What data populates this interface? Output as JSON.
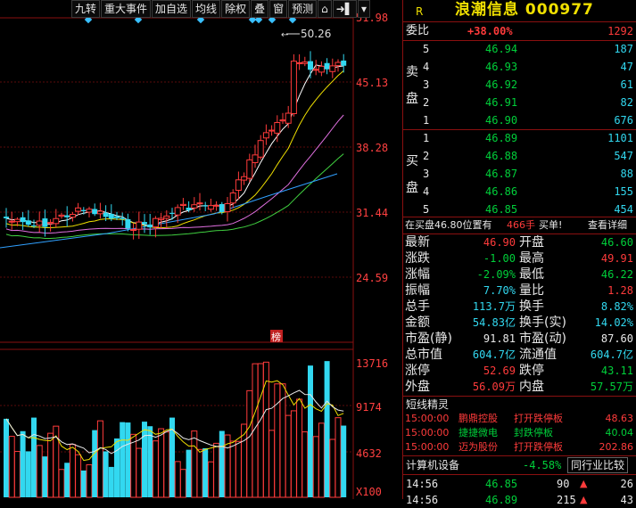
{
  "toolbar": {
    "items": [
      "九转",
      "重大事件",
      "加自选",
      "均线",
      "除权",
      "叠",
      "窗",
      "预测"
    ],
    "lock": "⌂",
    "arrow": "➜▌",
    "dropdown": "▾"
  },
  "chart": {
    "price_labels": [
      "51.98",
      "45.13",
      "38.28",
      "31.44",
      "24.59"
    ],
    "volume_labels": [
      "13716",
      "9174",
      "4632",
      "X100"
    ],
    "peak_label": "50.26",
    "badge": "榜"
  },
  "header": {
    "tag": "R",
    "title": "浪潮信息 000977"
  },
  "order": {
    "wb_label": "委比",
    "wb_pct": "+38.00%",
    "wb_diff": "1292",
    "sell_label": [
      "卖",
      "盘"
    ],
    "buy_label": [
      "买",
      "盘"
    ],
    "sell": [
      {
        "lvl": "5",
        "price": "46.94",
        "vol": "187"
      },
      {
        "lvl": "4",
        "price": "46.93",
        "vol": "47"
      },
      {
        "lvl": "3",
        "price": "46.92",
        "vol": "61"
      },
      {
        "lvl": "2",
        "price": "46.91",
        "vol": "82"
      },
      {
        "lvl": "1",
        "price": "46.90",
        "vol": "676"
      }
    ],
    "buy": [
      {
        "lvl": "1",
        "price": "46.89",
        "vol": "1101"
      },
      {
        "lvl": "2",
        "price": "46.88",
        "vol": "547"
      },
      {
        "lvl": "3",
        "price": "46.87",
        "vol": "88"
      },
      {
        "lvl": "4",
        "price": "46.86",
        "vol": "155"
      },
      {
        "lvl": "5",
        "price": "46.85",
        "vol": "454"
      }
    ]
  },
  "alert": {
    "text1": "在买盘46.80位置有",
    "text2": "466手",
    "text3": "买单!",
    "link": "查看详细"
  },
  "quote": [
    {
      "l1": "最新",
      "v1": "46.90",
      "c1": "red",
      "l2": "开盘",
      "v2": "46.60",
      "c2": "green"
    },
    {
      "l1": "涨跌",
      "v1": "-1.00",
      "c1": "green",
      "l2": "最高",
      "v2": "49.91",
      "c2": "red"
    },
    {
      "l1": "涨幅",
      "v1": "-2.09%",
      "c1": "green",
      "l2": "最低",
      "v2": "46.22",
      "c2": "green"
    },
    {
      "l1": "振幅",
      "v1": "7.70%",
      "c1": "cyan",
      "l2": "量比",
      "v2": "1.28",
      "c2": "red"
    },
    {
      "l1": "总手",
      "v1": "113.7万",
      "c1": "cyan",
      "l2": "换手",
      "v2": "8.82%",
      "c2": "cyan"
    },
    {
      "l1": "金额",
      "v1": "54.83亿",
      "c1": "cyan",
      "l2": "换手(实)",
      "v2": "14.02%",
      "c2": "cyan"
    },
    {
      "l1": "市盈(静)",
      "v1": "91.81",
      "c1": "white",
      "l2": "市盈(动)",
      "v2": "87.60",
      "c2": "white"
    },
    {
      "l1": "总市值",
      "v1": "604.7亿",
      "c1": "cyan",
      "l2": "流通值",
      "v2": "604.7亿",
      "c2": "cyan"
    },
    {
      "l1": "涨停",
      "v1": "52.69",
      "c1": "red",
      "l2": "跌停",
      "v2": "43.11",
      "c2": "green"
    },
    {
      "l1": "外盘",
      "v1": "56.09万",
      "c1": "red",
      "l2": "内盘",
      "v2": "57.57万",
      "c2": "green"
    }
  ],
  "sprite": {
    "title": "短线精灵",
    "rows": [
      {
        "time": "15:00:00",
        "name": "鹏鼎控股",
        "action": "打开跌停板",
        "val": "48.63",
        "color": "red"
      },
      {
        "time": "15:00:00",
        "name": "捷捷微电",
        "action": "封跌停板",
        "val": "40.04",
        "color": "green"
      },
      {
        "time": "15:00:00",
        "name": "迈为股份",
        "action": "打开跌停板",
        "val": "202.86",
        "color": "red"
      }
    ]
  },
  "sector": {
    "name": "计算机设备",
    "pct": "-4.58%",
    "btn": "同行业比较"
  },
  "ticks": [
    {
      "time": "14:56",
      "price": "46.85",
      "vol": "90",
      "dir": "▲",
      "n": "26"
    },
    {
      "time": "14:56",
      "price": "46.89",
      "vol": "215",
      "dir": "▲",
      "n": "43"
    }
  ],
  "colors": {
    "up": "#ff3b3b",
    "down": "#00d03a",
    "ma5": "#ffffff",
    "ma10": "#f0e000",
    "ma20": "#e070e0",
    "ma60": "#40d040",
    "ma120": "#30a0ff"
  }
}
